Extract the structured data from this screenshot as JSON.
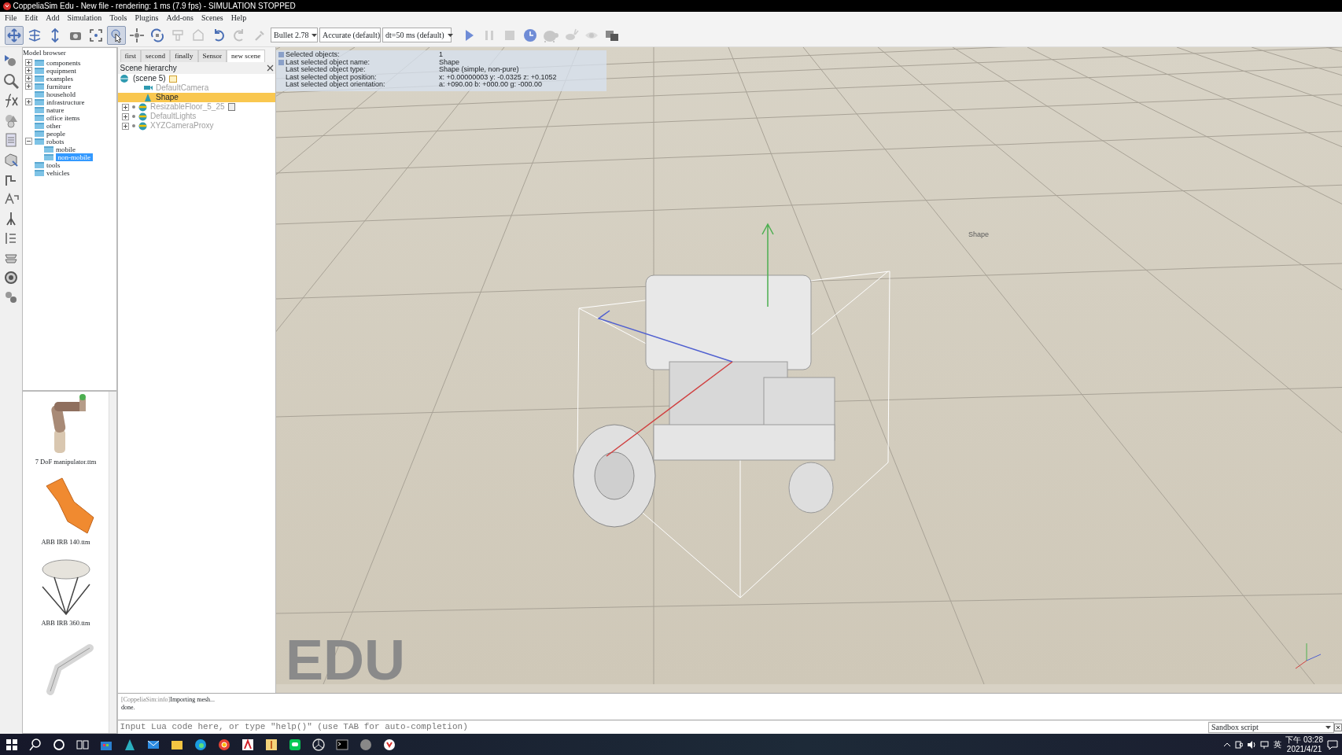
{
  "window": {
    "title": "CoppeliaSim Edu - New file - rendering: 1 ms (7.9 fps) - SIMULATION STOPPED"
  },
  "menu": [
    "File",
    "Edit",
    "Add",
    "Simulation",
    "Tools",
    "Plugins",
    "Add-ons",
    "Scenes",
    "Help"
  ],
  "toolbar": {
    "buttons": [
      {
        "kind": "pan",
        "pressed": true
      },
      {
        "kind": "orbit",
        "pressed": false
      },
      {
        "kind": "zoom",
        "pressed": false
      },
      {
        "kind": "camera",
        "pressed": false
      },
      {
        "kind": "fit",
        "pressed": false
      },
      {
        "kind": "select",
        "pressed": true
      },
      {
        "kind": "translate",
        "pressed": false
      },
      {
        "kind": "rotate",
        "pressed": false
      },
      {
        "kind": "assemble",
        "pressed": false,
        "disabled": true
      },
      {
        "kind": "transfer",
        "pressed": false,
        "disabled": true
      },
      {
        "kind": "undo",
        "pressed": false
      },
      {
        "kind": "redo",
        "pressed": false,
        "disabled": true
      },
      {
        "kind": "pick",
        "pressed": false,
        "disabled": true
      }
    ],
    "dropdowns": [
      {
        "value": "Bullet 2.78"
      },
      {
        "value": "Accurate (default)"
      },
      {
        "value": "dt=50 ms (default)"
      }
    ],
    "sim_buttons": [
      {
        "kind": "play",
        "pressed": false
      },
      {
        "kind": "pause",
        "pressed": false,
        "disabled": true
      },
      {
        "kind": "stop",
        "pressed": false,
        "disabled": true
      },
      {
        "kind": "realtime",
        "pressed": false
      },
      {
        "kind": "slower",
        "pressed": false,
        "disabled": true
      },
      {
        "kind": "faster",
        "pressed": false,
        "disabled": true
      },
      {
        "kind": "eye",
        "pressed": false,
        "disabled": true
      },
      {
        "kind": "windows",
        "pressed": false
      }
    ]
  },
  "model_browser": {
    "title": "Model browser",
    "items": [
      {
        "label": "components",
        "expandable": true,
        "selected": false
      },
      {
        "label": "equipment",
        "expandable": true,
        "selected": false
      },
      {
        "label": "examples",
        "expandable": true,
        "selected": false
      },
      {
        "label": "furniture",
        "expandable": true,
        "selected": false
      },
      {
        "label": "household",
        "expandable": false,
        "selected": false
      },
      {
        "label": "infrastructure",
        "expandable": true,
        "selected": false
      },
      {
        "label": "nature",
        "expandable": false,
        "selected": false
      },
      {
        "label": "office items",
        "expandable": false,
        "selected": false
      },
      {
        "label": "other",
        "expandable": false,
        "selected": false
      },
      {
        "label": "people",
        "expandable": false,
        "selected": false
      },
      {
        "label": "robots",
        "expandable": true,
        "expanded": true,
        "selected": false,
        "children": [
          {
            "label": "mobile",
            "expandable": false,
            "selected": false
          },
          {
            "label": "non-mobile",
            "expandable": false,
            "selected": true
          }
        ]
      },
      {
        "label": "tools",
        "expandable": false,
        "selected": false
      },
      {
        "label": "vehicles",
        "expandable": false,
        "selected": false
      }
    ],
    "thumbnails": [
      {
        "caption": "7 DoF manipulator.ttm",
        "kind": "arm"
      },
      {
        "caption": "ABB IRB 140.ttm",
        "kind": "orange-arm"
      },
      {
        "caption": "ABB IRB 360.ttm",
        "kind": "delta"
      },
      {
        "kind": "arm-grey"
      }
    ]
  },
  "scene_tabs": [
    {
      "label": "first",
      "selected": false
    },
    {
      "label": "second",
      "selected": false
    },
    {
      "label": "finally",
      "selected": false
    },
    {
      "label": "Sensor",
      "selected": false
    },
    {
      "label": "new scene",
      "selected": true
    }
  ],
  "scene_hierarchy": {
    "title": "Scene hierarchy",
    "root": {
      "label": "(scene 5)",
      "trailing_icon": true,
      "children": [
        {
          "label": "DefaultCamera",
          "kind": "camera",
          "greyed": true,
          "selected": false,
          "expandable": false,
          "trailing_icon": false
        },
        {
          "label": "Shape",
          "kind": "shape",
          "greyed": false,
          "selected": true,
          "expandable": false,
          "trailing_icon": false
        },
        {
          "label": "ResizableFloor_5_25",
          "kind": "dummy",
          "greyed": true,
          "selected": false,
          "expandable": true,
          "trailing_icon": true
        },
        {
          "label": "DefaultLights",
          "kind": "dummy",
          "greyed": true,
          "selected": false,
          "expandable": true,
          "trailing_icon": false
        },
        {
          "label": "XYZCameraProxy",
          "kind": "dummy",
          "greyed": true,
          "selected": false,
          "expandable": true,
          "trailing_icon": false
        }
      ]
    }
  },
  "info": [
    {
      "label": "Selected objects:",
      "value": "1"
    },
    {
      "label": "Last selected object name:",
      "value": "Shape"
    },
    {
      "label": "Last selected object type:",
      "value": "Shape (simple, non-pure)"
    },
    {
      "label": "Last selected object position:",
      "value": "x: +0.00000003   y: -0.0325   z: +0.1052"
    },
    {
      "label": "Last selected object orientation:",
      "value": "a: +090.00   b: +000.00   g: -000.00"
    }
  ],
  "viewport": {
    "object_label": "Shape",
    "edition_mark": "EDU"
  },
  "console": {
    "lines": [
      {
        "prefix": "[CoppeliaSim:info]",
        "message": "Importing mesh..."
      },
      {
        "message": "done."
      }
    ],
    "placeholder": "Input Lua code here, or type \"help()\" (use TAB for auto-completion)",
    "script": "Sandbox script"
  },
  "taskbar": {
    "time": "下午 03:28",
    "date": "2021/4/21",
    "ime": "英"
  }
}
